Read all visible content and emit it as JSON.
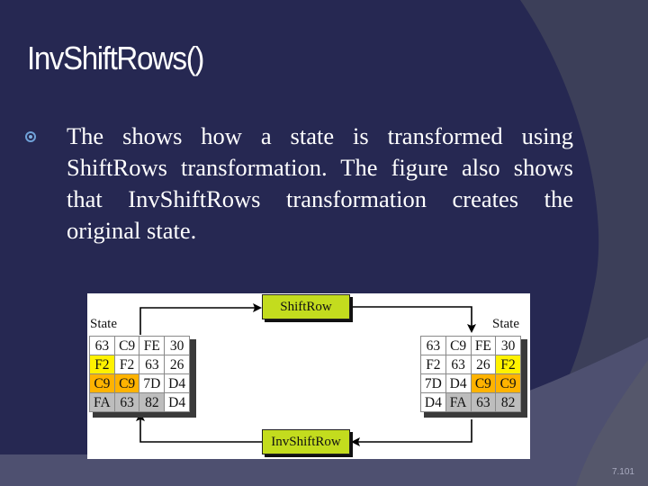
{
  "slide": {
    "title": "InvShiftRows()",
    "bullets": [
      {
        "icon": "circle-bullet-icon",
        "text": "The shows how a state is transformed using ShiftRows transformation. The figure also shows that InvShiftRows transformation creates the original state."
      }
    ],
    "page_number": "7.101",
    "colors": {
      "background_navy": "#262852",
      "background_slate": "#3c3f59",
      "background_bottom": "#4e5070",
      "bullet_accent": "#6fa1d8",
      "operation_box": "#c3dc1e",
      "highlight_yellow": "#fff200",
      "highlight_orange": "#ffb300",
      "highlight_gray": "#bdbdbd"
    }
  },
  "diagram": {
    "left_state": {
      "label": "State",
      "rows": [
        [
          "63",
          "C9",
          "FE",
          "30"
        ],
        [
          "F2",
          "F2",
          "63",
          "26"
        ],
        [
          "C9",
          "C9",
          "7D",
          "D4"
        ],
        [
          "FA",
          "63",
          "82",
          "D4"
        ]
      ],
      "highlights": [
        [
          "white",
          "white",
          "white",
          "white"
        ],
        [
          "yellow",
          "white",
          "white",
          "white"
        ],
        [
          "orange",
          "orange",
          "white",
          "white"
        ],
        [
          "gray",
          "gray",
          "gray",
          "white"
        ]
      ]
    },
    "right_state": {
      "label": "State",
      "rows": [
        [
          "63",
          "C9",
          "FE",
          "30"
        ],
        [
          "F2",
          "63",
          "26",
          "F2"
        ],
        [
          "7D",
          "D4",
          "C9",
          "C9"
        ],
        [
          "D4",
          "FA",
          "63",
          "82"
        ]
      ],
      "highlights": [
        [
          "white",
          "white",
          "white",
          "white"
        ],
        [
          "white",
          "white",
          "white",
          "yellow"
        ],
        [
          "white",
          "white",
          "orange",
          "orange"
        ],
        [
          "white",
          "gray",
          "gray",
          "gray"
        ]
      ]
    },
    "forward_operation": "ShiftRow",
    "inverse_operation": "InvShiftRow"
  }
}
